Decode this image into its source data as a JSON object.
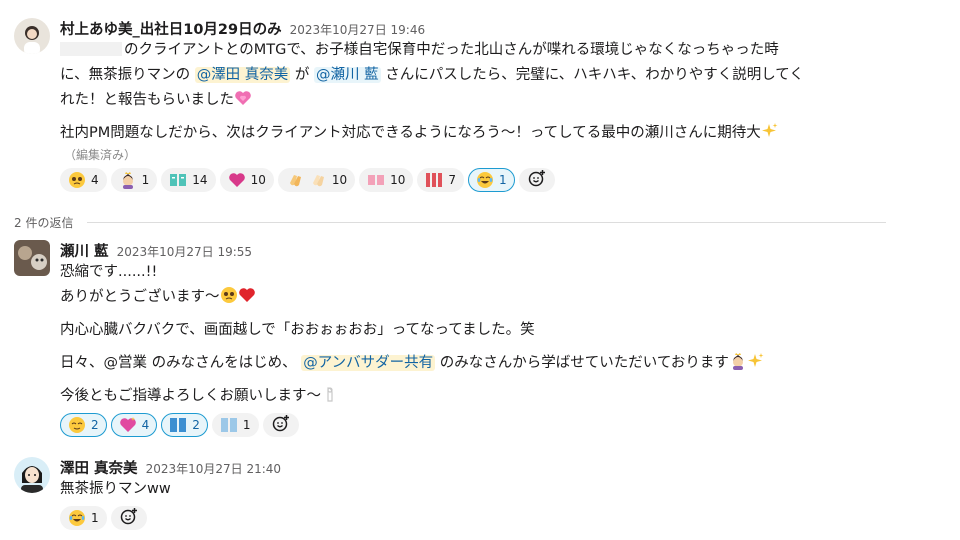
{
  "thread": {
    "reply_count_label": "2 件の返信",
    "messages": [
      {
        "author": "村上あゆ美_出社日10月29日のみ",
        "time": "2023年10月27日 19:46",
        "line1": "のクライアントとのMTGで、お子様自宅保育中だった北山さんが喋れる環境じゃなくなっちゃった時",
        "line2_a": "に、無茶振りマンの",
        "mention1": "@澤田 真奈美",
        "line2_b": "が",
        "mention2": "@瀬川 藍",
        "line2_c": "さんにパスしたら、完璧に、ハキハキ、わかりやすく説明してく",
        "line3": "れた！と報告もらいました",
        "line4": "社内PM問題なしだから、次はクライアント対応できるようになろう〜！ってしてる最中の瀬川さんに期待大",
        "edited": "（編集済み）",
        "reactions": [
          {
            "icon": "pleading-face-icon",
            "count": "4",
            "mine": false
          },
          {
            "icon": "person-crown-icon",
            "count": "1",
            "mine": false
          },
          {
            "icon": "custom-text-emoji-icon",
            "count": "14",
            "mine": false
          },
          {
            "icon": "heart-exclaim-icon",
            "count": "10",
            "mine": false
          },
          {
            "icon": "clap-icon",
            "count": "10",
            "mine": false
          },
          {
            "icon": "custom-pink-text-icon",
            "count": "10",
            "mine": false
          },
          {
            "icon": "custom-red-text-icon",
            "count": "7",
            "mine": false
          },
          {
            "icon": "joy-face-icon",
            "count": "1",
            "mine": true
          }
        ]
      },
      {
        "author": "瀬川 藍",
        "time": "2023年10月27日 19:55",
        "line1": "恐縮です......!!",
        "line2": "ありがとうございます〜",
        "line3": "内心心臓バクバクで、画面越しで「おおぉぉおお」ってなってました。笑",
        "line4_a": "日々、@営業 のみなさんをはじめ、",
        "mention": "@アンバサダー共有",
        "line4_b": "のみなさんから学ばせていただいております",
        "line5": "今後ともご指導よろしくお願いします〜",
        "reactions": [
          {
            "icon": "relieved-face-icon",
            "count": "2",
            "mine": true
          },
          {
            "icon": "sparkling-heart-icon",
            "count": "4",
            "mine": true
          },
          {
            "icon": "custom-blue-text-icon",
            "count": "2",
            "mine": true
          },
          {
            "icon": "custom-lightblue-text-icon",
            "count": "1",
            "mine": false
          }
        ]
      },
      {
        "author": "澤田 真奈美",
        "time": "2023年10月27日 21:40",
        "line1": "無茶振りマンww",
        "reactions": [
          {
            "icon": "joy-face-icon",
            "count": "1",
            "mine": false
          }
        ]
      }
    ]
  },
  "colors": {
    "mention_bg": "#fdf3d1",
    "mention_text": "#1264a3",
    "reaction_bg": "#f2f2f2",
    "reaction_mine_border": "#1d9bd1",
    "divider": "#dddddd"
  }
}
